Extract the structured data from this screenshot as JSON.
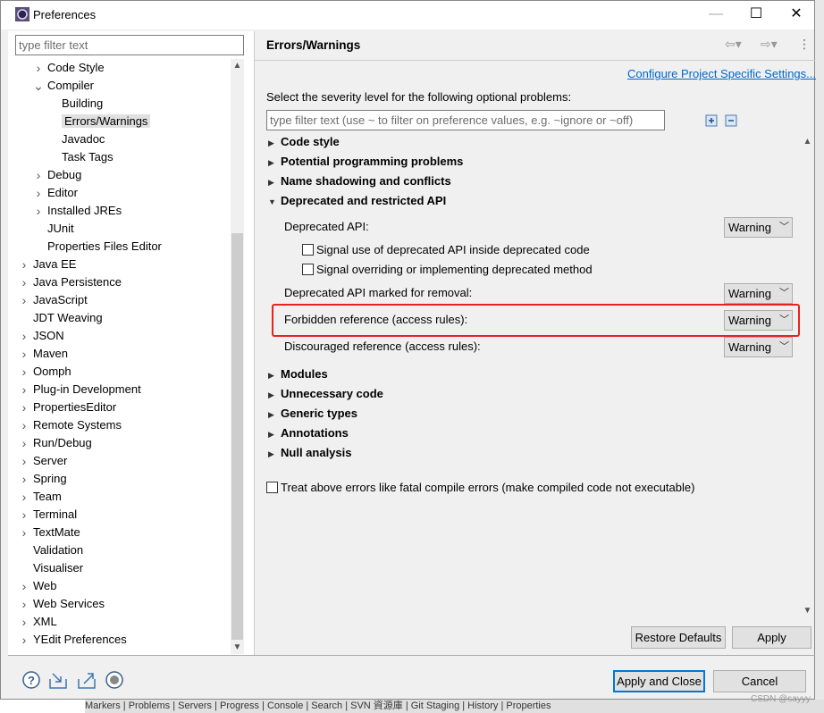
{
  "window": {
    "title": "Preferences",
    "minimize": "—",
    "maximize": "☐",
    "close": "✕"
  },
  "left": {
    "filter_placeholder": "type filter text",
    "tree": [
      {
        "label": "Code Style",
        "level": 1,
        "state": "collapsed"
      },
      {
        "label": "Compiler",
        "level": 1,
        "state": "expanded"
      },
      {
        "label": "Building",
        "level": 2
      },
      {
        "label": "Errors/Warnings",
        "level": 2,
        "selected": true
      },
      {
        "label": "Javadoc",
        "level": 2
      },
      {
        "label": "Task Tags",
        "level": 2
      },
      {
        "label": "Debug",
        "level": 1,
        "state": "collapsed"
      },
      {
        "label": "Editor",
        "level": 1,
        "state": "collapsed"
      },
      {
        "label": "Installed JREs",
        "level": 1,
        "state": "collapsed"
      },
      {
        "label": "JUnit",
        "level": 1
      },
      {
        "label": "Properties Files Editor",
        "level": 1
      },
      {
        "label": "Java EE",
        "level": 0,
        "state": "collapsed"
      },
      {
        "label": "Java Persistence",
        "level": 0,
        "state": "collapsed"
      },
      {
        "label": "JavaScript",
        "level": 0,
        "state": "collapsed"
      },
      {
        "label": "JDT Weaving",
        "level": 0
      },
      {
        "label": "JSON",
        "level": 0,
        "state": "collapsed"
      },
      {
        "label": "Maven",
        "level": 0,
        "state": "collapsed"
      },
      {
        "label": "Oomph",
        "level": 0,
        "state": "collapsed"
      },
      {
        "label": "Plug-in Development",
        "level": 0,
        "state": "collapsed"
      },
      {
        "label": "PropertiesEditor",
        "level": 0,
        "state": "collapsed"
      },
      {
        "label": "Remote Systems",
        "level": 0,
        "state": "collapsed"
      },
      {
        "label": "Run/Debug",
        "level": 0,
        "state": "collapsed"
      },
      {
        "label": "Server",
        "level": 0,
        "state": "collapsed"
      },
      {
        "label": "Spring",
        "level": 0,
        "state": "collapsed"
      },
      {
        "label": "Team",
        "level": 0,
        "state": "collapsed"
      },
      {
        "label": "Terminal",
        "level": 0,
        "state": "collapsed"
      },
      {
        "label": "TextMate",
        "level": 0,
        "state": "collapsed"
      },
      {
        "label": "Validation",
        "level": 0
      },
      {
        "label": "Visualiser",
        "level": 0
      },
      {
        "label": "Web",
        "level": 0,
        "state": "collapsed"
      },
      {
        "label": "Web Services",
        "level": 0,
        "state": "collapsed"
      },
      {
        "label": "XML",
        "level": 0,
        "state": "collapsed"
      },
      {
        "label": "YEdit Preferences",
        "level": 0,
        "state": "collapsed"
      }
    ]
  },
  "right": {
    "header": "Errors/Warnings",
    "configure_link": "Configure Project Specific Settings...",
    "severity_label": "Select the severity level for the following optional problems:",
    "filter_placeholder": "type filter text (use ~ to filter on preference values, e.g. ~ignore or ~off)",
    "sections_top": [
      "Code style",
      "Potential programming problems",
      "Name shadowing and conflicts"
    ],
    "deprecated_section": "Deprecated and restricted API",
    "deprecated_api": {
      "label": "Deprecated API:",
      "value": "Warning"
    },
    "check1": "Signal use of deprecated API inside deprecated code",
    "check2": "Signal overriding or implementing deprecated method",
    "removal": {
      "label": "Deprecated API marked for removal:",
      "value": "Warning"
    },
    "forbidden": {
      "label": "Forbidden reference (access rules):",
      "value": "Warning"
    },
    "discouraged": {
      "label": "Discouraged reference (access rules):",
      "value": "Warning"
    },
    "sections_bottom": [
      "Modules",
      "Unnecessary code",
      "Generic types",
      "Annotations",
      "Null analysis"
    ],
    "treat_fatal": "Treat above errors like fatal compile errors (make compiled code not executable)",
    "restore_defaults": "Restore Defaults",
    "apply": "Apply"
  },
  "footer": {
    "apply_close": "Apply and Close",
    "cancel": "Cancel"
  },
  "ide_bottom": "Markers | Problems | Servers | Progress | Console | Search | SVN 資源庫 | Git Staging | History | Properties",
  "watermark": "CSDN @sayyy",
  "colors": {
    "highlight_box": "#e8231f",
    "link": "#0066cc",
    "default_button_border": "#0078d7"
  }
}
